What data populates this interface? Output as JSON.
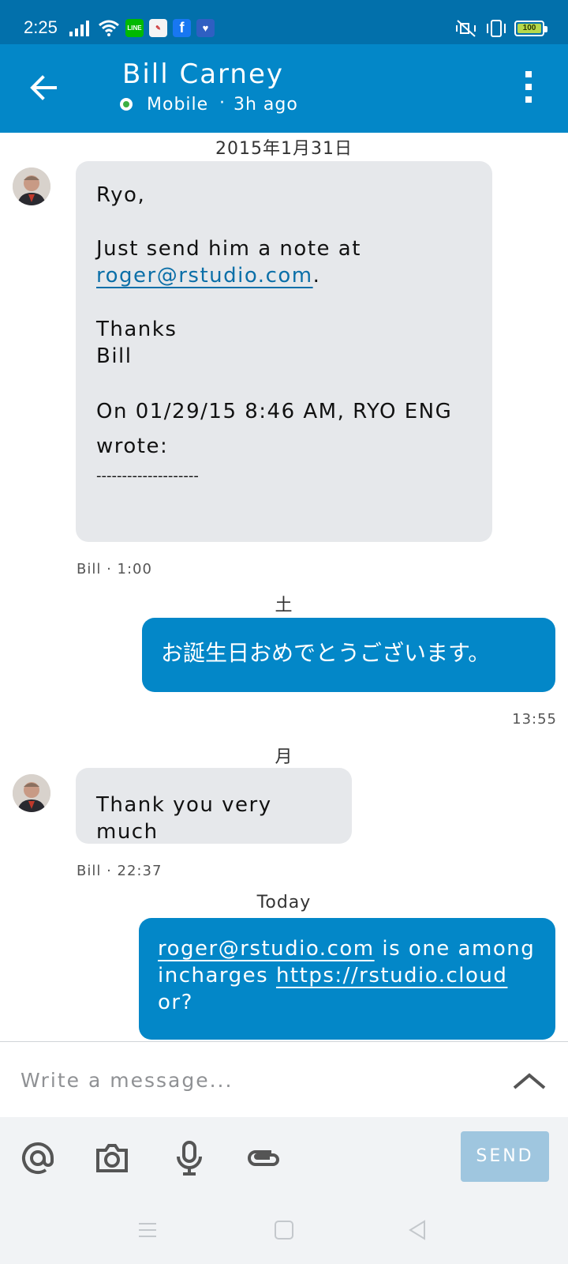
{
  "status_bar": {
    "time": "2:25",
    "battery": "100",
    "app_icons": [
      "line-icon",
      "notes-app-icon",
      "facebook-icon",
      "vpn-icon"
    ],
    "colors": {
      "background": "#0270ab",
      "battery_fill": "#b7d94b"
    }
  },
  "header": {
    "name": "Bill Carney",
    "presence": "Mobile",
    "separator": "·",
    "last_seen": "3h ago",
    "colors": {
      "background": "#0387c8",
      "presence": "#3cb043"
    }
  },
  "messages": {
    "date1": "2015年1月31日",
    "msg1": {
      "greeting": "Ryo,",
      "line1": "Just send him a note at",
      "email": "roger@rstudio.com",
      "period": ".",
      "thanks": "Thanks",
      "sign": "Bill",
      "quote_line1": "On 01/29/15 8:46 AM, RYO ENG",
      "quote_line2": "wrote:",
      "divider": "--------------------",
      "meta": "Bill · 1:00"
    },
    "date2": "土",
    "msg2": {
      "text": "お誕生日おめでとうございます。",
      "meta": "13:55"
    },
    "date3": "月",
    "msg3": {
      "text": "Thank you very much",
      "meta": "Bill · 22:37"
    },
    "date4": "Today",
    "msg4": {
      "email": "roger@rstudio.com",
      "text_a": " is one among",
      "text_b": "incharges ",
      "url": "https://rstudio.cloud",
      "text_c": "or?"
    },
    "colors": {
      "incoming_bubble": "#e6e8eb",
      "outgoing_bubble": "#0387c8",
      "link": "#0b6fa8"
    }
  },
  "composer": {
    "placeholder": "Write a message...",
    "send_label": "SEND",
    "tools": [
      "at-icon",
      "camera-icon",
      "microphone-icon",
      "paperclip-icon"
    ],
    "colors": {
      "send_disabled": "#9fc6df",
      "toolbar": "#f1f3f5"
    }
  },
  "navigation": [
    "menu-icon",
    "home-icon",
    "back-triangle-icon"
  ]
}
